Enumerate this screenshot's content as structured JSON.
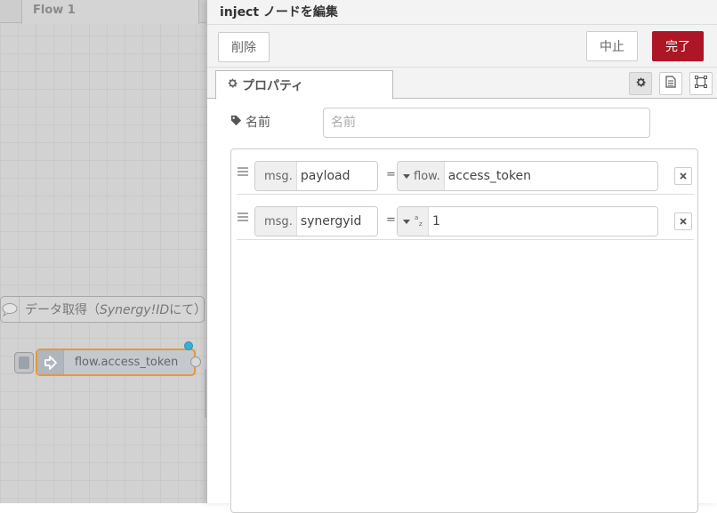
{
  "workspace": {
    "tab_label": "Flow 1",
    "comment_node": {
      "label_prefix": "データ取得（",
      "label_italic": "Synergy!ID",
      "label_suffix": "にて）"
    },
    "inject_node": {
      "label": "flow.access_token"
    }
  },
  "tray": {
    "title": "inject ノードを編集",
    "delete_label": "削除",
    "cancel_label": "中止",
    "done_label": "完了",
    "accent_color": "#ad1625",
    "tabs": {
      "properties_label": "プロパティ"
    },
    "name": {
      "label": "名前",
      "value": "",
      "placeholder": "名前"
    },
    "rules": [
      {
        "prefix": "msg.",
        "property": "payload",
        "equals": "=",
        "value_type_label": "flow.",
        "value": "access_token"
      },
      {
        "prefix": "msg.",
        "property": "synergyid",
        "equals": "=",
        "value_type_icon": "string-az-icon",
        "value": "1"
      }
    ]
  }
}
